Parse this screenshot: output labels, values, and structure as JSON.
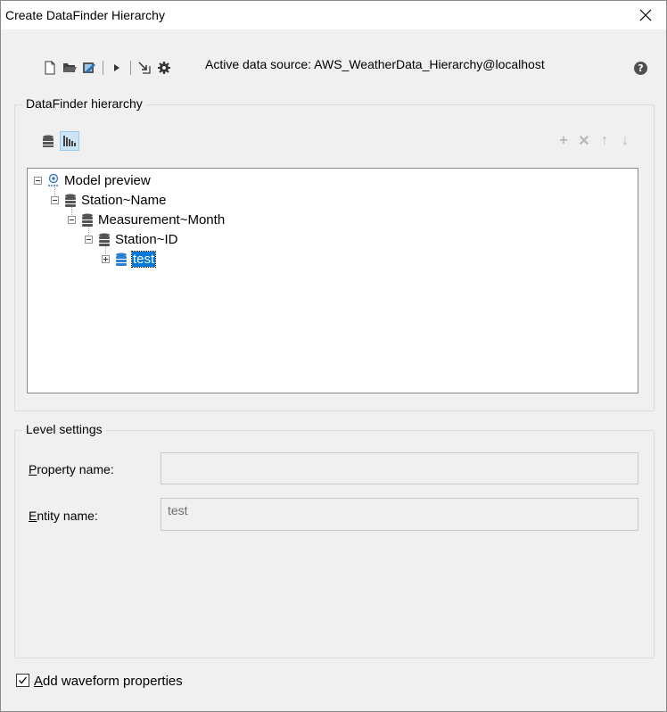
{
  "window": {
    "title": "Create DataFinder Hierarchy"
  },
  "toolbar": {
    "buttons": [
      "new-icon",
      "open-folder-icon",
      "edit-icon",
      "run-icon",
      "import-icon",
      "settings-icon"
    ],
    "active_source_label": "Active data source: AWS_WeatherData_Hierarchy@localhost",
    "help": "?"
  },
  "hierarchy": {
    "group_title": "DataFinder hierarchy",
    "nodes": [
      {
        "label": "Model preview",
        "icon": "model-preview-icon",
        "state": "expanded"
      },
      {
        "label": "Station~Name",
        "icon": "database-icon",
        "state": "expanded"
      },
      {
        "label": "Measurement~Month",
        "icon": "database-icon",
        "state": "expanded"
      },
      {
        "label": "Station~ID",
        "icon": "database-icon",
        "state": "expanded"
      },
      {
        "label": "test",
        "icon": "database-blue-icon",
        "state": "collapsed",
        "selected": true
      }
    ],
    "right_tools": [
      "+",
      "✕",
      "↑",
      "↓"
    ]
  },
  "level_settings": {
    "group_title": "Level settings",
    "property_label_prefix": "P",
    "property_label_rest": "roperty name:",
    "property_value": "",
    "entity_label_prefix": "E",
    "entity_label_rest": "ntity name:",
    "entity_value": "test"
  },
  "footer": {
    "checkbox_checked": true,
    "checkbox_label_prefix": "A",
    "checkbox_label_rest": "dd waveform properties"
  }
}
